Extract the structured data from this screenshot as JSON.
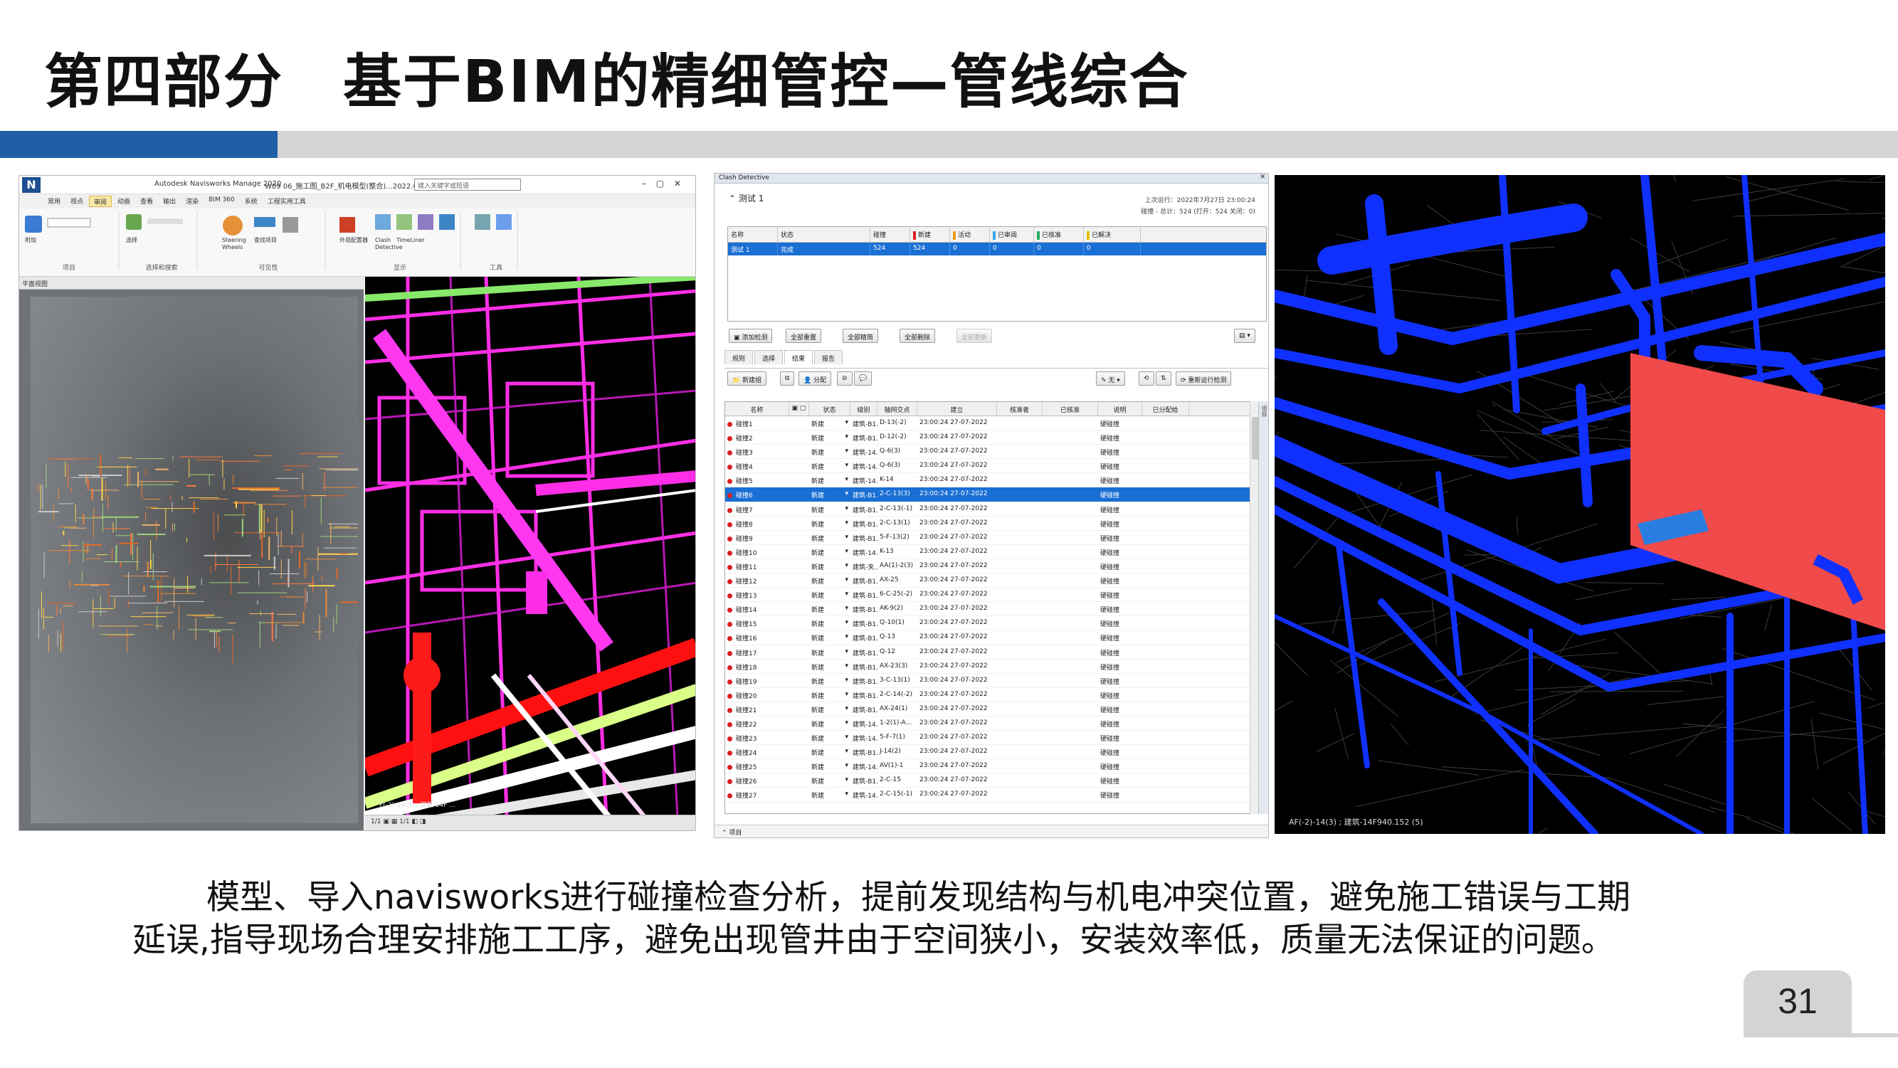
{
  "slide": {
    "title": "第四部分　基于BIM的精细管控—管线综合",
    "caption_line1": "模型、导入navisworks进行碰撞检查分析，提前发现结构与机电冲突位置，避免施工错误与工期",
    "caption_line2": "延误,指导现场合理安排施工工序，避免出现管井由于空间狭小，安装效率低，质量无法保证的问题。",
    "page_number": "31",
    "accent_color": "#1f5fa6",
    "band_color": "#d4d4d4"
  },
  "navisworks": {
    "app_title": "Autodesk Navisworks Manage 2020",
    "file_title": "W09 06_施工图_B2F_机电模型(整合)...2022.07.23.n...",
    "search_placeholder": "键入关键字或短语",
    "tabs": [
      "常用",
      "视点",
      "审阅",
      "动画",
      "查看",
      "输出",
      "渲染",
      "BIM 360",
      "系统",
      "工程实用工具"
    ],
    "active_tab": "审阅",
    "ribbon_groups": [
      "项目",
      "选择和搜索",
      "可见性",
      "显示",
      "工具"
    ],
    "ribbon_labels": [
      "附加",
      "选择",
      "Steering Wheels",
      "查找项目",
      "外观配置器",
      "Clash Detective",
      "TimeLiner"
    ],
    "plan_panel_title": "平面视图",
    "status_bar": "1/1   ▣ ▦ 1/1 ◧ ◨",
    "view_caption": "F(-2)-14(3) ; 建筑-14F ..."
  },
  "clash": {
    "panel_title": "Clash Detective",
    "test_name": "测试 1",
    "last_run": "上次运行：2022年7月27日 23:00:24",
    "summary": "碰撞 - 总计：524 (打开：524 关闭：0)",
    "top_headers": [
      "名称",
      "状态",
      "碰撞",
      "新建",
      "活动",
      "已审阅",
      "已核准",
      "已解决"
    ],
    "top_marks": [
      "",
      "",
      "",
      "#d22",
      "#f39c12",
      "#3aa5e6",
      "#27ae60",
      "#e6c200"
    ],
    "top_row": [
      "测试 1",
      "完成",
      "524",
      "524",
      "0",
      "0",
      "0",
      "0"
    ],
    "buttons": [
      "添加检测",
      "全部重置",
      "全部精简",
      "全部删除",
      "全部更新"
    ],
    "subtabs": [
      "规则",
      "选择",
      "结果",
      "报告"
    ],
    "active_subtab": "结果",
    "toolbar_new_group": "新建组",
    "toolbar_assign": "分配",
    "toolbar_none": "无",
    "toolbar_rerun": "重新运行检测",
    "result_headers": [
      "名称",
      "",
      "状态",
      "级别",
      "轴网交点",
      "建立",
      "核准者",
      "已核准",
      "说明",
      "已分配给"
    ],
    "side_label": "项目",
    "footer": "项目",
    "selected_index": 5,
    "rows": [
      [
        "碰撞1",
        "新建",
        "建筑-B1...",
        "D-13(-2)",
        "23:00:24 27-07-2022",
        "硬碰撞"
      ],
      [
        "碰撞2",
        "新建",
        "建筑-B1...",
        "D-12(-2)",
        "23:00:24 27-07-2022",
        "硬碰撞"
      ],
      [
        "碰撞3",
        "新建",
        "建筑-14...",
        "Q-6(3)",
        "23:00:24 27-07-2022",
        "硬碰撞"
      ],
      [
        "碰撞4",
        "新建",
        "建筑-14...",
        "Q-6(3)",
        "23:00:24 27-07-2022",
        "硬碰撞"
      ],
      [
        "碰撞5",
        "新建",
        "建筑-14...",
        "K-14",
        "23:00:24 27-07-2022",
        "硬碰撞"
      ],
      [
        "碰撞6",
        "新建",
        "建筑-B1...",
        "2-C-13(3)",
        "23:00:24 27-07-2022",
        "硬碰撞"
      ],
      [
        "碰撞7",
        "新建",
        "建筑-B1...",
        "2-C-13(-1)",
        "23:00:24 27-07-2022",
        "硬碰撞"
      ],
      [
        "碰撞8",
        "新建",
        "建筑-B1...",
        "2-C-13(1)",
        "23:00:24 27-07-2022",
        "硬碰撞"
      ],
      [
        "碰撞9",
        "新建",
        "建筑-B1...",
        "5-F-13(2)",
        "23:00:24 27-07-2022",
        "硬碰撞"
      ],
      [
        "碰撞10",
        "新建",
        "建筑-14...",
        "K-13",
        "23:00:24 27-07-2022",
        "硬碰撞"
      ],
      [
        "碰撞11",
        "新建",
        "建筑-夹...",
        "AA(1)-2(3)",
        "23:00:24 27-07-2022",
        "硬碰撞"
      ],
      [
        "碰撞12",
        "新建",
        "建筑-B1...",
        "AX-25",
        "23:00:24 27-07-2022",
        "硬碰撞"
      ],
      [
        "碰撞13",
        "新建",
        "建筑-B1...",
        "6-C-25(-2)",
        "23:00:24 27-07-2022",
        "硬碰撞"
      ],
      [
        "碰撞14",
        "新建",
        "建筑-B1...",
        "AK-9(2)",
        "23:00:24 27-07-2022",
        "硬碰撞"
      ],
      [
        "碰撞15",
        "新建",
        "建筑-B1...",
        "Q-10(1)",
        "23:00:24 27-07-2022",
        "硬碰撞"
      ],
      [
        "碰撞16",
        "新建",
        "建筑-B1...",
        "Q-13",
        "23:00:24 27-07-2022",
        "硬碰撞"
      ],
      [
        "碰撞17",
        "新建",
        "建筑-B1...",
        "Q-12",
        "23:00:24 27-07-2022",
        "硬碰撞"
      ],
      [
        "碰撞18",
        "新建",
        "建筑-B1...",
        "AX-23(3)",
        "23:00:24 27-07-2022",
        "硬碰撞"
      ],
      [
        "碰撞19",
        "新建",
        "建筑-B1...",
        "3-C-13(1)",
        "23:00:24 27-07-2022",
        "硬碰撞"
      ],
      [
        "碰撞20",
        "新建",
        "建筑-B1...",
        "2-C-14(-2)",
        "23:00:24 27-07-2022",
        "硬碰撞"
      ],
      [
        "碰撞21",
        "新建",
        "建筑-B1...",
        "AX-24(1)",
        "23:00:24 27-07-2022",
        "硬碰撞"
      ],
      [
        "碰撞22",
        "新建",
        "建筑-14...",
        "1-2(1)-A...",
        "23:00:24 27-07-2022",
        "硬碰撞"
      ],
      [
        "碰撞23",
        "新建",
        "建筑-14...",
        "5-F-7(1)",
        "23:00:24 27-07-2022",
        "硬碰撞"
      ],
      [
        "碰撞24",
        "新建",
        "建筑-B1...",
        "J-14(2)",
        "23:00:24 27-07-2022",
        "硬碰撞"
      ],
      [
        "碰撞25",
        "新建",
        "建筑-14...",
        "AV(1)-1",
        "23:00:24 27-07-2022",
        "硬碰撞"
      ],
      [
        "碰撞26",
        "新建",
        "建筑-B1...",
        "2-C-15",
        "23:00:24 27-07-2022",
        "硬碰撞"
      ],
      [
        "碰撞27",
        "新建",
        "建筑-14...",
        "2-C-15(-1)",
        "23:00:24 27-07-2022",
        "硬碰撞"
      ]
    ]
  },
  "view_right": {
    "caption": "AF(-2)-14(3) ; 建筑-14F940.152 (5)"
  }
}
